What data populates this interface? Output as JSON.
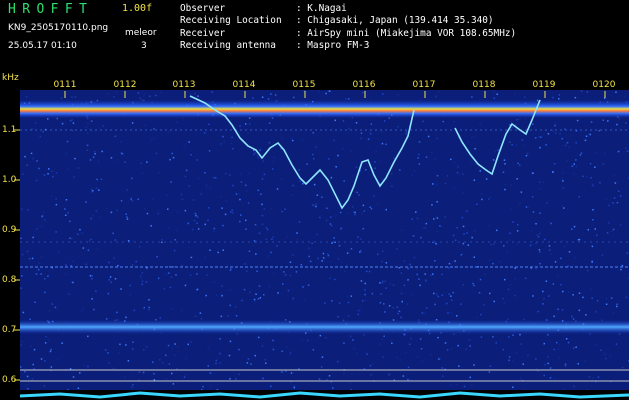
{
  "header": {
    "app_title": "HROFFT",
    "version": "1.00f",
    "filename": "KN9_2505170110.png",
    "datetime": "25.05.17 01:10",
    "meleor_label": "meleor",
    "meteor_count": "3",
    "meta": [
      {
        "label": "Observer",
        "value": ": K.Nagai"
      },
      {
        "label": "Receiving Location",
        "value": ": Chigasaki, Japan (139.414 35.340)"
      },
      {
        "label": "Receiver",
        "value": ": AirSpy mini (Miakejima VOR 108.65MHz)"
      },
      {
        "label": "Receiving antenna",
        "value": ": Maspro FM-3"
      }
    ]
  },
  "axis": {
    "unit": "kHz",
    "y_ticks": [
      "1.1",
      "1.0",
      "0.9",
      "0.8",
      "0.7",
      "0.6"
    ],
    "x_ticks": [
      "0111",
      "0112",
      "0113",
      "0114",
      "0115",
      "0116",
      "0117",
      "0118",
      "0119",
      "0120"
    ]
  },
  "colors": {
    "background": "#000000",
    "title_green": "#2fe06a",
    "label_yellow": "#f2e24a",
    "spectrum_base": "#0b1f7a",
    "echo_cyan": "#7fe0ff"
  }
}
